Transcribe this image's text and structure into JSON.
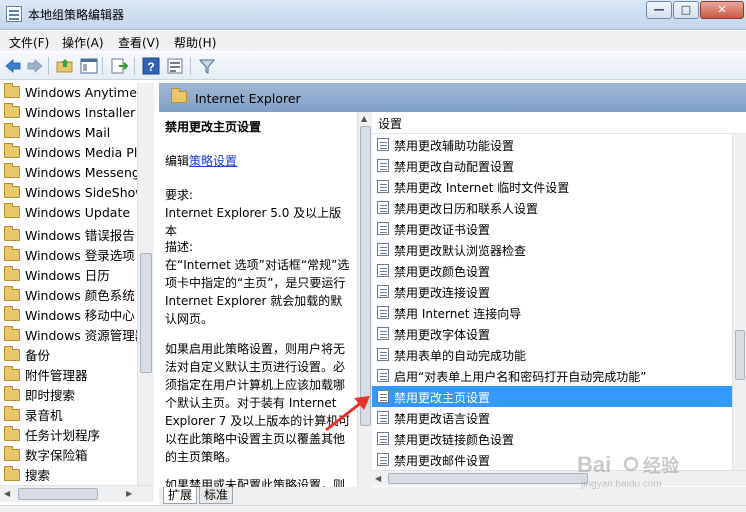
{
  "window": {
    "title": "本地组策略编辑器",
    "minimize": "—",
    "maximize": "□",
    "close": "✕"
  },
  "menu": [
    "文件(F)",
    "操作(A)",
    "查看(V)",
    "帮助(H)"
  ],
  "toolbar_icons": [
    "back-arrow-icon",
    "forward-arrow-icon",
    "up-folder-icon",
    "show-hide-tree-icon",
    "export-list-icon",
    "help-icon",
    "properties-icon",
    "filter-icon"
  ],
  "tree": {
    "items": [
      "Windows Anytime U",
      "Windows Installer",
      "Windows Mail",
      "Windows Media Pla",
      "Windows Messeng",
      "Windows SideShow",
      "Windows Update",
      "Windows 错误报告",
      "Windows 登录选项",
      "Windows 日历",
      "Windows 颜色系统",
      "Windows 移动中心",
      "Windows 资源管理器",
      "备份",
      "附件管理器",
      "即时搜索",
      "录音机",
      "任务计划程序",
      "数字保险箱",
      "搜索"
    ]
  },
  "pane": {
    "folder_name": "Internet Explorer"
  },
  "description": {
    "title": "禁用更改主页设置",
    "edit_prefix": "编辑",
    "edit_link": "策略设置",
    "req_label": "要求:",
    "req_value": "Internet Explorer 5.0 及以上版本",
    "desc_label": "描述:",
    "desc_text": "在“Internet 选项”对话框“常规”选项卡中指定的“主页”，是只要运行 Internet Explorer 就会加载的默认网页。",
    "para2": "如果启用此策略设置，则用户将无法对自定义默认主页进行设置。必须指定在用户计算机上应该加载哪个默认主页。对于装有 Internet Explorer 7 及以上版本的计算机可以在此策略中设置主页以覆盖其他的主页策略。",
    "para3": "如果禁用或未配置此策略设置，则"
  },
  "list": {
    "header": "设置",
    "rows": [
      "禁用更改辅助功能设置",
      "禁用更改自动配置设置",
      "禁用更改 Internet 临时文件设置",
      "禁用更改日历和联系人设置",
      "禁用更改证书设置",
      "禁用更改默认浏览器检查",
      "禁用更改颜色设置",
      "禁用更改连接设置",
      "禁用 Internet 连接向导",
      "禁用更改字体设置",
      "禁用表单的自动完成功能",
      "启用“对表单上用户名和密码打开自动完成功能”",
      "禁用更改主页设置",
      "禁用更改语言设置",
      "禁用更改链接颜色设置",
      "禁用更改邮件设置"
    ],
    "selected_index": 12
  },
  "tabs": [
    "扩展",
    "标准"
  ],
  "watermark": {
    "brand": "Bai",
    "brand2": "经验",
    "url": "jingyan.baidu.com"
  },
  "colors": {
    "selection": "#3399ff",
    "pane_header": "#8daccf",
    "annotation_arrow": "#e8312a"
  }
}
